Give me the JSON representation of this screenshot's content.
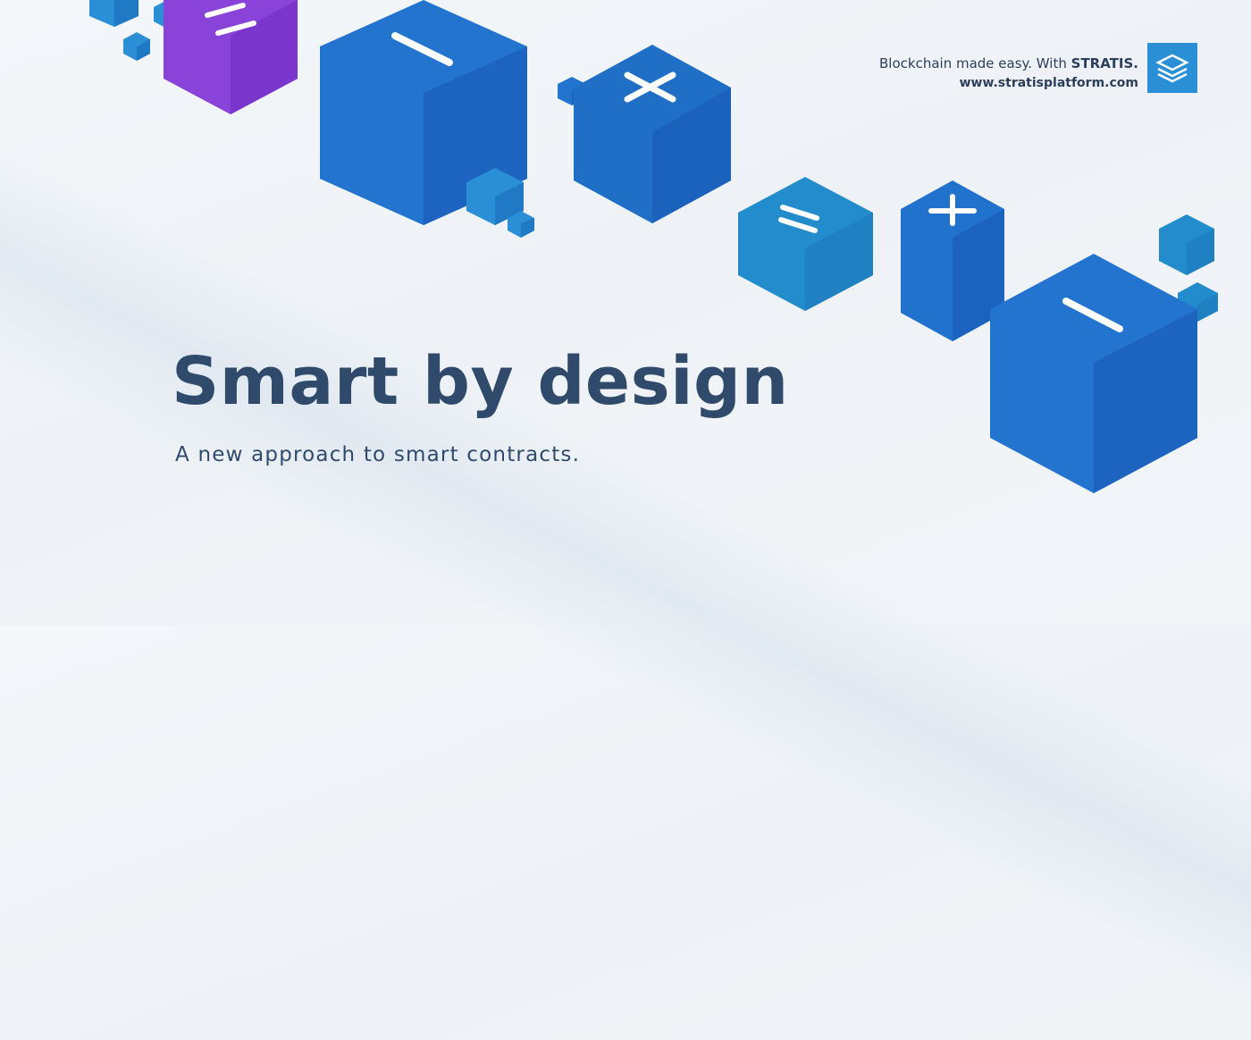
{
  "brand": {
    "tagline_prefix": "Blockchain made easy. With ",
    "tagline_name": "STRATIS.",
    "url": "www.stratisplatform.com",
    "logo_icon": "stacked-layers-icon"
  },
  "hero": {
    "headline": "Smart by design",
    "subhead": "A new approach to smart contracts."
  },
  "cubes": [
    {
      "symbol": "equals",
      "color": "#7f3bd2"
    },
    {
      "symbol": "minus",
      "color": "#1f6fc7"
    },
    {
      "symbol": "times",
      "color": "#1e6ac5"
    },
    {
      "symbol": "equals",
      "color": "#238ccd"
    },
    {
      "symbol": "plus",
      "color": "#1f6fc7"
    },
    {
      "symbol": "minus",
      "color": "#1f6fc7"
    }
  ],
  "colors": {
    "text": "#2f4a6b",
    "accent_blue": "#1f6fc7",
    "accent_purple": "#7f3bd2",
    "accent_light_blue": "#2a8fd4"
  }
}
